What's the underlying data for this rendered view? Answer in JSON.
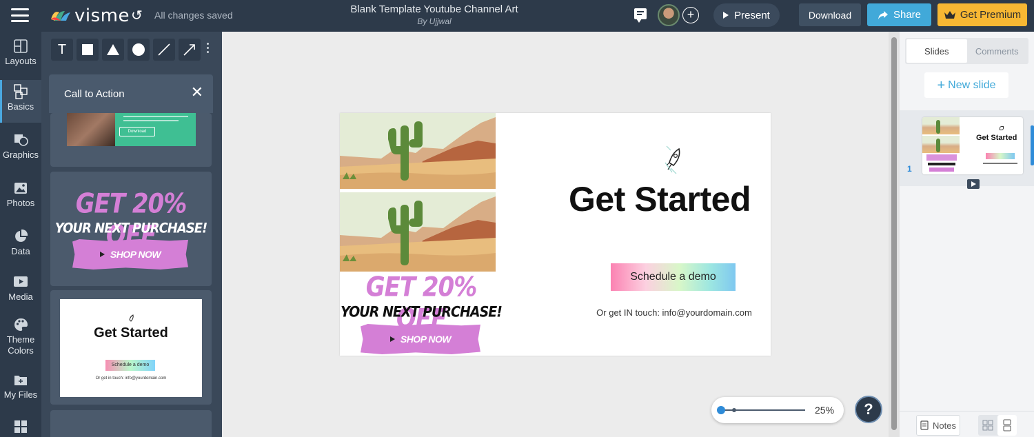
{
  "app": {
    "logo_text": "visme",
    "save_status": "All changes saved",
    "doc_title": "Blank Template Youtube Channel Art",
    "doc_author": "By Ujjwal"
  },
  "toolbar": {
    "present_label": "Present",
    "download_label": "Download",
    "share_label": "Share",
    "premium_label": "Get Premium"
  },
  "sidebar": {
    "items": [
      {
        "label": "Layouts",
        "icon": "layout-icon"
      },
      {
        "label": "Basics",
        "icon": "abc-blocks-icon"
      },
      {
        "label": "Graphics",
        "icon": "graphics-icon"
      },
      {
        "label": "Photos",
        "icon": "photo-icon"
      },
      {
        "label": "Data",
        "icon": "pie-chart-icon"
      },
      {
        "label": "Media",
        "icon": "media-icon"
      },
      {
        "label": "Theme",
        "label2": "Colors",
        "icon": "palette-icon"
      },
      {
        "label": "My Files",
        "icon": "folder-icon"
      }
    ]
  },
  "tools": {
    "text_tool": "T"
  },
  "panel": {
    "header": "Call to Action",
    "card1": {
      "download_label": "Download"
    },
    "card2": {
      "headline": "GET 20% OFF",
      "sub": "YOUR NEXT PURCHASE!",
      "button": "SHOP NOW"
    },
    "card3": {
      "title": "Get Started",
      "button": "Schedule a demo",
      "contact": "Or get in touch: info@yourdomain.com"
    }
  },
  "slide": {
    "headline": "Get Started",
    "button": "Schedule a demo",
    "contact": "Or get IN touch: info@yourdomain.com",
    "promo_headline": "GET 20% OFF",
    "promo_sub": "YOUR NEXT PURCHASE!",
    "promo_button": "SHOP NOW"
  },
  "zoom": {
    "value": "25%",
    "level": 0.0
  },
  "help": {
    "label": "?"
  },
  "right_panel": {
    "tab_slides": "Slides",
    "tab_comments": "Comments",
    "new_slide": "New slide",
    "slide_number": "1",
    "thumb_title": "Get Started",
    "notes_label": "Notes"
  },
  "colors": {
    "topbar": "#2d3a4a",
    "share": "#41a9d9",
    "premium": "#f7b733",
    "promo_pink": "#d47fd6"
  }
}
